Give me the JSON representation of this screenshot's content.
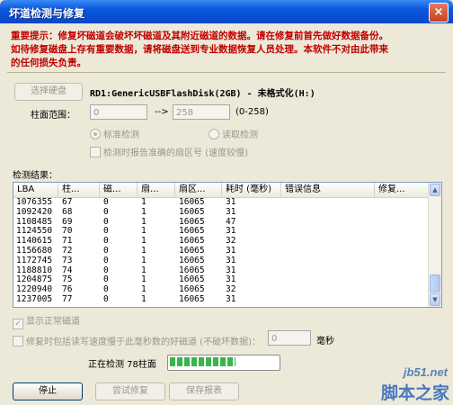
{
  "window": {
    "title": "坏道检测与修复",
    "close_glyph": "×"
  },
  "warning": {
    "line1": "重要提示：修复坏磁道会破坏坏磁道及其附近磁道的数据。请在修复前首先做好数据备份。",
    "line2": "如待修复磁盘上存有重要数据，请将磁盘送到专业数据恢复人员处理。本软件不对由此带来",
    "line3": "的任何损失负责。"
  },
  "disk": {
    "select_label": "选择硬盘",
    "name": "RD1:GenericUSBFlashDisk(2GB) - 未格式化(H:)"
  },
  "cylinder": {
    "label": "柱面范围：",
    "from": "0",
    "arrow": "-->",
    "to": "258",
    "range": "(0-258)"
  },
  "mode": {
    "standard": "标准检测",
    "read": "读取检测",
    "report_label": "检测时报告准确的扇区号 (速度较慢)"
  },
  "results": {
    "label": "检测结果：",
    "columns": [
      "LBA",
      "柱...",
      "磁...",
      "扇...",
      "扇区...",
      "耗时 (毫秒)",
      "错误信息",
      "修复..."
    ],
    "rows": [
      [
        "1076355",
        "67",
        "0",
        "1",
        "16065",
        "31"
      ],
      [
        "1092420",
        "68",
        "0",
        "1",
        "16065",
        "31"
      ],
      [
        "1108485",
        "69",
        "0",
        "1",
        "16065",
        "47"
      ],
      [
        "1124550",
        "70",
        "0",
        "1",
        "16065",
        "31"
      ],
      [
        "1140615",
        "71",
        "0",
        "1",
        "16065",
        "32"
      ],
      [
        "1156680",
        "72",
        "0",
        "1",
        "16065",
        "31"
      ],
      [
        "1172745",
        "73",
        "0",
        "1",
        "16065",
        "31"
      ],
      [
        "1188810",
        "74",
        "0",
        "1",
        "16065",
        "31"
      ],
      [
        "1204875",
        "75",
        "0",
        "1",
        "16065",
        "31"
      ],
      [
        "1220940",
        "76",
        "0",
        "1",
        "16065",
        "32"
      ],
      [
        "1237005",
        "77",
        "0",
        "1",
        "16065",
        "31"
      ]
    ]
  },
  "options": {
    "show_normal": "显示正常磁道",
    "repair_slow": "修复时包括读写速度慢于此毫秒数的好磁道 (不破坏数据)：",
    "ms_value": "0",
    "ms_unit": "毫秒"
  },
  "status": {
    "text": "正在检测  78柱面",
    "progress": 0.62
  },
  "buttons": {
    "stop": "停止",
    "try_repair": "尝试修复",
    "save_report": "保存报表"
  },
  "watermark": {
    "site": "jb51.net",
    "name": "脚本之家"
  },
  "colors": {
    "warning": "#c00000",
    "progress": "#39b549",
    "title_bar": "#0b56dc"
  }
}
